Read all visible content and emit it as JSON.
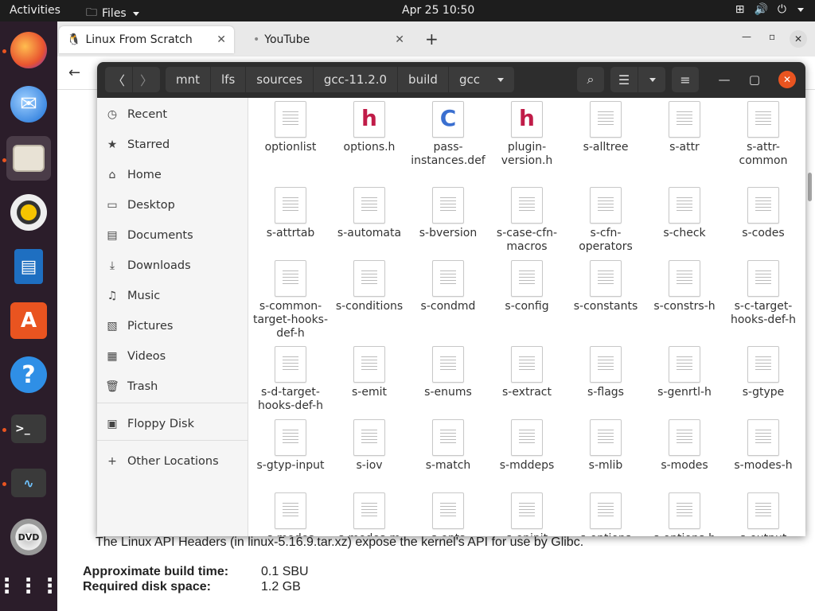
{
  "topbar": {
    "activities": "Activities",
    "app_menu": "Files",
    "clock": "Apr 25  10:50"
  },
  "browser": {
    "tabs": [
      {
        "label": "Linux From Scratch"
      },
      {
        "label": "YouTube"
      }
    ],
    "web": {
      "intro": "The Linux API Headers (in linux-5.16.9.tar.xz) expose the kernel's API for use by Glibc.",
      "build_time_label": "Approximate build time:",
      "build_time_value": "0.1 SBU",
      "disk_label": "Required disk space:",
      "disk_value": "1.2 GB"
    }
  },
  "files": {
    "breadcrumb": [
      "mnt",
      "lfs",
      "sources",
      "gcc-11.2.0",
      "build",
      "gcc"
    ],
    "sidebar": [
      {
        "label": "Recent",
        "icon": "clock-icon"
      },
      {
        "label": "Starred",
        "icon": "star-icon"
      },
      {
        "label": "Home",
        "icon": "home-icon"
      },
      {
        "label": "Desktop",
        "icon": "desktop-icon"
      },
      {
        "label": "Documents",
        "icon": "documents-icon"
      },
      {
        "label": "Downloads",
        "icon": "download-icon"
      },
      {
        "label": "Music",
        "icon": "music-icon"
      },
      {
        "label": "Pictures",
        "icon": "pictures-icon"
      },
      {
        "label": "Videos",
        "icon": "videos-icon"
      },
      {
        "label": "Trash",
        "icon": "trash-icon"
      },
      {
        "label": "Floppy Disk",
        "icon": "floppy-icon"
      },
      {
        "label": "Other Locations",
        "icon": "plus-icon"
      }
    ],
    "items": [
      {
        "name": "optionlist",
        "type": "text"
      },
      {
        "name": "options.h",
        "type": "h"
      },
      {
        "name": "pass-instances.def",
        "type": "c"
      },
      {
        "name": "plugin-version.h",
        "type": "h"
      },
      {
        "name": "s-alltree",
        "type": "text"
      },
      {
        "name": "s-attr",
        "type": "text"
      },
      {
        "name": "s-attr-common",
        "type": "text"
      },
      {
        "name": "s-attrtab",
        "type": "text"
      },
      {
        "name": "s-automata",
        "type": "text"
      },
      {
        "name": "s-bversion",
        "type": "text"
      },
      {
        "name": "s-case-cfn-macros",
        "type": "text"
      },
      {
        "name": "s-cfn-operators",
        "type": "text"
      },
      {
        "name": "s-check",
        "type": "text"
      },
      {
        "name": "s-codes",
        "type": "text"
      },
      {
        "name": "s-common-target-hooks-def-h",
        "type": "text"
      },
      {
        "name": "s-conditions",
        "type": "text"
      },
      {
        "name": "s-condmd",
        "type": "text"
      },
      {
        "name": "s-config",
        "type": "text"
      },
      {
        "name": "s-constants",
        "type": "text"
      },
      {
        "name": "s-constrs-h",
        "type": "text"
      },
      {
        "name": "s-c-target-hooks-def-h",
        "type": "text"
      },
      {
        "name": "s-d-target-hooks-def-h",
        "type": "text"
      },
      {
        "name": "s-emit",
        "type": "text"
      },
      {
        "name": "s-enums",
        "type": "text"
      },
      {
        "name": "s-extract",
        "type": "text"
      },
      {
        "name": "s-flags",
        "type": "text"
      },
      {
        "name": "s-genrtl-h",
        "type": "text"
      },
      {
        "name": "s-gtype",
        "type": "text"
      },
      {
        "name": "s-gtyp-input",
        "type": "text"
      },
      {
        "name": "s-iov",
        "type": "text"
      },
      {
        "name": "s-match",
        "type": "text"
      },
      {
        "name": "s-mddeps",
        "type": "text"
      },
      {
        "name": "s-mlib",
        "type": "text"
      },
      {
        "name": "s-modes",
        "type": "text"
      },
      {
        "name": "s-modes-h",
        "type": "text"
      },
      {
        "name": "s-modes",
        "type": "text"
      },
      {
        "name": "s-modes-m",
        "type": "text"
      },
      {
        "name": "s-opts",
        "type": "text"
      },
      {
        "name": "s-opinit",
        "type": "text"
      },
      {
        "name": "s-options",
        "type": "text"
      },
      {
        "name": "s-options-h",
        "type": "text"
      },
      {
        "name": "s-output",
        "type": "text"
      }
    ]
  }
}
